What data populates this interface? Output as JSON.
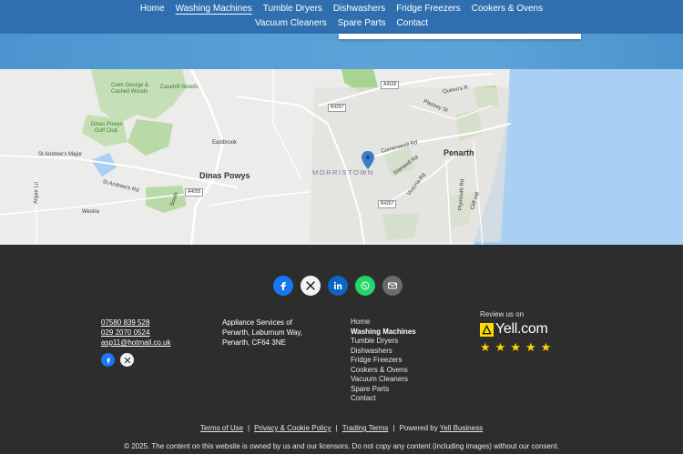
{
  "nav": {
    "row1": [
      "Home",
      "Washing Machines",
      "Tumble Dryers",
      "Dishwashers",
      "Fridge Freezers",
      "Cookers & Ovens"
    ],
    "row2": [
      "Vacuum Cleaners",
      "Spare Parts",
      "Contact"
    ],
    "active": "Washing Machines"
  },
  "map": {
    "labels": {
      "cwm_george": "Cwm George &",
      "cashell_woods": "Cashell Woods",
      "casehill": "Casehill Woods",
      "golf1": "Dinas Powys",
      "golf2": "Golf Club",
      "st_andrews_major": "St Andrew's Major",
      "st_andrews_rd": "St Andrew's Rd",
      "eastbrook": "Eastbrook",
      "dinas_powys": "Dinas Powys",
      "morristown": "MORRISTOWN",
      "penarth": "Penarth",
      "cornerswell": "Cornerswell Rd",
      "stanwell": "Stanwell Rd",
      "victoria": "Victoria Rd",
      "plymouth": "Plymouth Rd",
      "cliff_hill": "Cliff Hill",
      "plassey": "Plassey St",
      "queens": "Queen's R",
      "westra": "Westra",
      "south": "South",
      "argae": "Argae Ln"
    },
    "badges": {
      "a4160": "A4160",
      "b4267a": "B4267",
      "b4267b": "B4267",
      "a4055": "A4055"
    }
  },
  "footer": {
    "phone1": "07580 839 528",
    "phone2": "029 2070 0524",
    "email": "asp11@hotmail.co.uk",
    "address": [
      "Appliance Services of",
      "Penarth, Laburnum Way,",
      "Penarth, CF64 3NE"
    ],
    "links": [
      "Home",
      "Washing Machines",
      "Tumble Dryers",
      "Dishwashers",
      "Fridge Freezers",
      "Cookers & Ovens",
      "Vacuum Cleaners",
      "Spare Parts",
      "Contact"
    ],
    "yell_review": "Review us on",
    "yell_brand": "Yell.com",
    "yell_stars": 5,
    "legal": {
      "terms": "Terms of Use",
      "privacy": "Privacy & Cookie Policy",
      "trading": "Trading Terms",
      "powered_prefix": "Powered by",
      "powered_link": "Yell Business"
    },
    "copyright": "© 2025. The content on this website is owned by us and our licensors. Do not copy any content (including images) without our consent."
  },
  "colors": {
    "header": "#2f6fb0",
    "facebook": "#1877f2",
    "x": "#111111",
    "linkedin": "#0a66c2",
    "whatsapp": "#25d366",
    "email": "#6b6b6b",
    "yell": "#ffdd00"
  }
}
